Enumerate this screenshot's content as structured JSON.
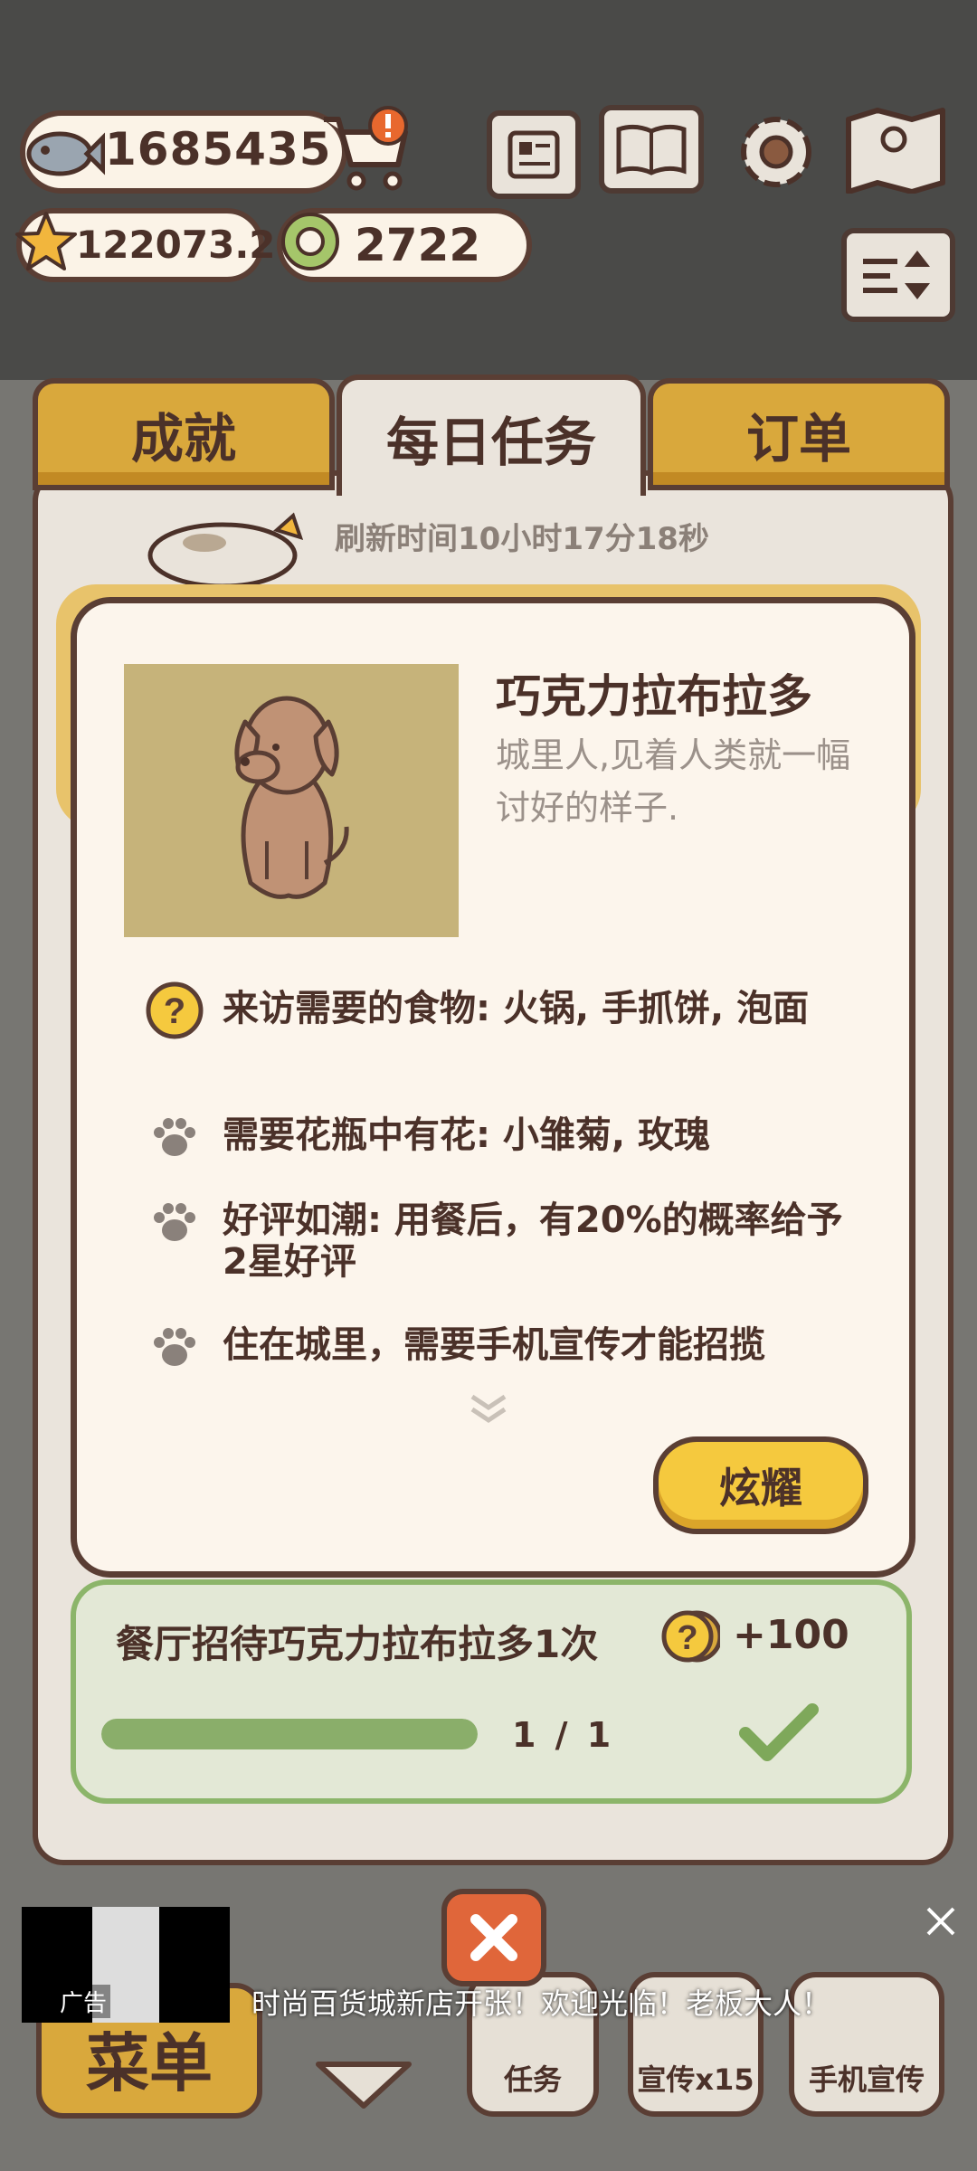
{
  "resources": {
    "fish": "1685435",
    "stars": "122073.2",
    "rings": "2722"
  },
  "tabs": [
    {
      "label": "成就"
    },
    {
      "label": "每日任务"
    },
    {
      "label": "订单"
    }
  ],
  "refresh_text": "刷新时间10小时17分18秒",
  "customer": {
    "name": "巧克力拉布拉多",
    "description": "城里人,见着人类就一幅讨好的样子.",
    "traits": [
      {
        "icon": "question-coin-icon",
        "text": "来访需要的食物: 火锅, 手抓饼, 泡面"
      },
      {
        "icon": "paw-icon",
        "text": "需要花瓶中有花: 小雏菊, 玫瑰"
      },
      {
        "icon": "paw-icon",
        "text": "好评如潮: 用餐后，有20%的概率给予2星好评"
      },
      {
        "icon": "paw-icon",
        "text": "住在城里，需要手机宣传才能招揽"
      }
    ],
    "show_button": "炫耀"
  },
  "task": {
    "text": "餐厅招待巧克力拉布拉多1次",
    "reward": "+100",
    "progress_text": "1 / 1",
    "progress": 1.0
  },
  "ad": {
    "label": "广告",
    "text": "时尚百货城新店开张！欢迎光临！老板大人！"
  },
  "bottom_nav": {
    "menu": "菜单",
    "tasks": "任务",
    "promo": "宣传x15",
    "phone_promo": "手机宣传"
  },
  "colors": {
    "outline": "#5a3e34",
    "gold": "#d9a83c",
    "card": "#fcf5ec",
    "task_green": "#8aae6a",
    "button_yellow": "#f5c93e"
  }
}
